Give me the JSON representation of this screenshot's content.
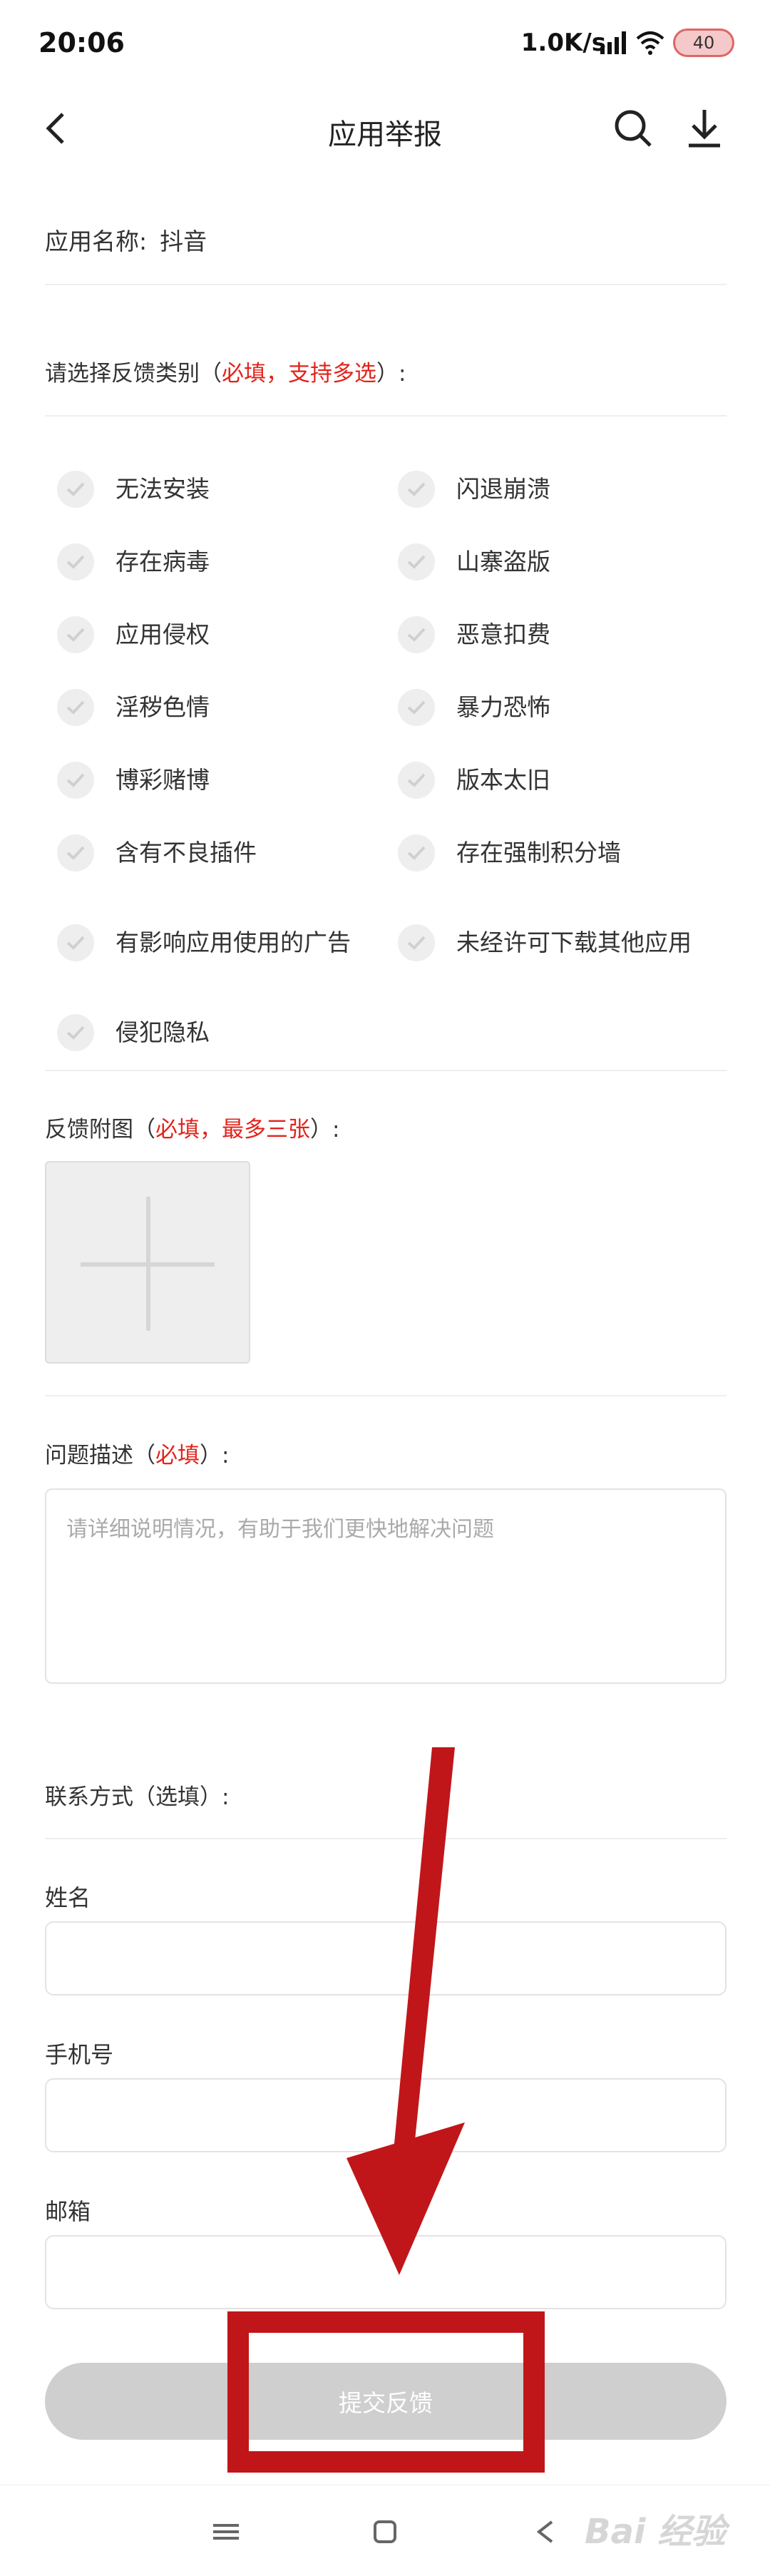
{
  "status_bar": {
    "time": "20:06",
    "net_speed": "1.0K/s",
    "battery": "40"
  },
  "header": {
    "title": "应用举报"
  },
  "app_info": {
    "label": "应用名称:",
    "value": "抖音"
  },
  "category_section": {
    "label_prefix": "请选择反馈类别（",
    "label_req": "必填，支持多选",
    "label_suffix": "）:"
  },
  "categories": [
    "无法安装",
    "闪退崩溃",
    "存在病毒",
    "山寨盗版",
    "应用侵权",
    "恶意扣费",
    "淫秽色情",
    "暴力恐怖",
    "博彩赌博",
    "版本太旧",
    "含有不良插件",
    "存在强制积分墙",
    "有影响应用使用的广告",
    "未经许可下载其他应用",
    "侵犯隐私"
  ],
  "attachment_section": {
    "label_prefix": "反馈附图（",
    "label_req": "必填，最多三张",
    "label_suffix": "）:"
  },
  "description_section": {
    "label_prefix": "问题描述（",
    "label_req": "必填",
    "label_suffix": "）:",
    "placeholder": "请详细说明情况，有助于我们更快地解决问题"
  },
  "contact_section": {
    "label": "联系方式（选填）:",
    "name_label": "姓名",
    "phone_label": "手机号",
    "email_label": "邮箱"
  },
  "submit": {
    "label": "提交反馈"
  },
  "watermark": {
    "text": "Bai 经验"
  },
  "colors": {
    "required": "#e2231a",
    "annotation": "#c0161a",
    "button_disabled": "#cfcfcf"
  }
}
